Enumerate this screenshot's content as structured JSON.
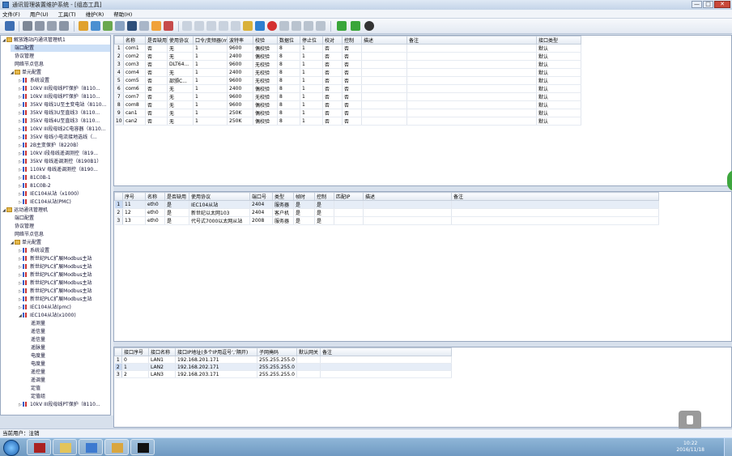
{
  "window": {
    "title": "通讯管理装置维护系统 - [组态工具]",
    "buttons": [
      "—",
      "□",
      "✕"
    ]
  },
  "menu": [
    "文件(F)",
    "用户(U)",
    "工具(T)",
    "维护(R)",
    "帮助(H)"
  ],
  "tree": [
    {
      "label": "解放路站内通讯管理机1",
      "level": 0,
      "icon": "folder",
      "twisty": "◢",
      "selected": false
    },
    {
      "label": "端口配置",
      "level": 1,
      "icon": "none",
      "twisty": "",
      "selected": true
    },
    {
      "label": "协议管理",
      "level": 1,
      "icon": "none",
      "twisty": "",
      "selected": false
    },
    {
      "label": "网络节点信息",
      "level": 1,
      "icon": "none",
      "twisty": "",
      "selected": false
    },
    {
      "label": "单元配置",
      "level": 1,
      "icon": "folder",
      "twisty": "◢",
      "selected": false
    },
    {
      "label": "系统设置",
      "level": 2,
      "icon": "node",
      "twisty": "▷",
      "selected": false
    },
    {
      "label": "10kV III段母线PT保护（8110...",
      "level": 2,
      "icon": "node",
      "twisty": "▷",
      "selected": false
    },
    {
      "label": "10kV III段母线PT保护（8110...",
      "level": 2,
      "icon": "node",
      "twisty": "▷",
      "selected": false
    },
    {
      "label": "35kV 母线1U至主变电站（8110...",
      "level": 2,
      "icon": "node",
      "twisty": "▷",
      "selected": false
    },
    {
      "label": "35kV 母线3U至直线3（8110...",
      "level": 2,
      "icon": "node",
      "twisty": "▷",
      "selected": false
    },
    {
      "label": "35kV 母线4U至直线3（8110...",
      "level": 2,
      "icon": "node",
      "twisty": "▷",
      "selected": false
    },
    {
      "label": "10kV III段母线2C电容器（8110...",
      "level": 2,
      "icon": "node",
      "twisty": "▷",
      "selected": false
    },
    {
      "label": "35kV 母线小电流接地选线（...",
      "level": 2,
      "icon": "node",
      "twisty": "▷",
      "selected": false
    },
    {
      "label": "2B主变保护（8220B）",
      "level": 2,
      "icon": "node",
      "twisty": "▷",
      "selected": false
    },
    {
      "label": "10kV I段母线遥调测控（819...",
      "level": 2,
      "icon": "node",
      "twisty": "▷",
      "selected": false
    },
    {
      "label": "35kV 母线遥调测控（8190B1）",
      "level": 2,
      "icon": "node",
      "twisty": "▷",
      "selected": false
    },
    {
      "label": "110kV 母线遥调测控（8190...",
      "level": 2,
      "icon": "node",
      "twisty": "▷",
      "selected": false
    },
    {
      "label": "81C0B-1",
      "level": 2,
      "icon": "node",
      "twisty": "▷",
      "selected": false
    },
    {
      "label": "81C0B-2",
      "level": 2,
      "icon": "node",
      "twisty": "▷",
      "selected": false
    },
    {
      "label": "IEC104从站（x1000）",
      "level": 2,
      "icon": "node",
      "twisty": "▷",
      "selected": false
    },
    {
      "label": "IEC104从站(PMC)",
      "level": 2,
      "icon": "node",
      "twisty": "▷",
      "selected": false
    },
    {
      "label": "运动通讯管理机",
      "level": 0,
      "icon": "folder",
      "twisty": "◢",
      "selected": false
    },
    {
      "label": "端口配置",
      "level": 1,
      "icon": "none",
      "twisty": "",
      "selected": false
    },
    {
      "label": "协议管理",
      "level": 1,
      "icon": "none",
      "twisty": "",
      "selected": false
    },
    {
      "label": "网络节点信息",
      "level": 1,
      "icon": "none",
      "twisty": "",
      "selected": false
    },
    {
      "label": "单元配置",
      "level": 1,
      "icon": "folder",
      "twisty": "◢",
      "selected": false
    },
    {
      "label": "系统设置",
      "level": 2,
      "icon": "node",
      "twisty": "▷",
      "selected": false
    },
    {
      "label": "新世纪PLC扩展Modbus主站",
      "level": 2,
      "icon": "node",
      "twisty": "▷",
      "selected": false
    },
    {
      "label": "新世纪PLC扩展Modbus主站",
      "level": 2,
      "icon": "node",
      "twisty": "▷",
      "selected": false
    },
    {
      "label": "新世纪PLC扩展Modbus主站",
      "level": 2,
      "icon": "node",
      "twisty": "▷",
      "selected": false
    },
    {
      "label": "新世纪PLC扩展Modbus主站",
      "level": 2,
      "icon": "node",
      "twisty": "▷",
      "selected": false
    },
    {
      "label": "新世纪PLC扩展Modbus主站",
      "level": 2,
      "icon": "node",
      "twisty": "▷",
      "selected": false
    },
    {
      "label": "新世纪PLC扩展Modbus主站",
      "level": 2,
      "icon": "node",
      "twisty": "▷",
      "selected": false
    },
    {
      "label": "IEC104从站(pmc)",
      "level": 2,
      "icon": "node",
      "twisty": "▷",
      "selected": false
    },
    {
      "label": "IEC104从站(x1000)",
      "level": 2,
      "icon": "node",
      "twisty": "◢",
      "selected": false
    },
    {
      "label": "遥测量",
      "level": 3,
      "icon": "none",
      "twisty": "",
      "selected": false
    },
    {
      "label": "遥信量",
      "level": 3,
      "icon": "none",
      "twisty": "",
      "selected": false
    },
    {
      "label": "遥信量",
      "level": 3,
      "icon": "none",
      "twisty": "",
      "selected": false
    },
    {
      "label": "遥脉量",
      "level": 3,
      "icon": "none",
      "twisty": "",
      "selected": false
    },
    {
      "label": "电度量",
      "level": 3,
      "icon": "none",
      "twisty": "",
      "selected": false
    },
    {
      "label": "电度量",
      "level": 3,
      "icon": "none",
      "twisty": "",
      "selected": false
    },
    {
      "label": "遥控量",
      "level": 3,
      "icon": "none",
      "twisty": "",
      "selected": false
    },
    {
      "label": "遥调量",
      "level": 3,
      "icon": "none",
      "twisty": "",
      "selected": false
    },
    {
      "label": "定值",
      "level": 3,
      "icon": "none",
      "twisty": "",
      "selected": false
    },
    {
      "label": "定值组",
      "level": 3,
      "icon": "none",
      "twisty": "",
      "selected": false
    },
    {
      "label": "10kV III段母线PT保护（8110...",
      "level": 2,
      "icon": "node",
      "twisty": "▷",
      "selected": false
    }
  ],
  "serial_table": {
    "headers": [
      "",
      "名称",
      "是否缺用",
      "使用协议",
      "口令/变频器(ms)",
      "波特率",
      "校验",
      "数据位",
      "停止位",
      "校对",
      "控制",
      "描述",
      "备注",
      "接口类型"
    ],
    "rows": [
      [
        "1",
        "com1",
        "否",
        "无",
        "1",
        "9600",
        "偶校验",
        "8",
        "1",
        "否",
        "否",
        "",
        "",
        "默认"
      ],
      [
        "2",
        "com2",
        "否",
        "无",
        "1",
        "2400",
        "偶校验",
        "8",
        "1",
        "否",
        "否",
        "",
        "",
        "默认"
      ],
      [
        "3",
        "com3",
        "否",
        "DLT64...",
        "1",
        "9600",
        "无校验",
        "8",
        "1",
        "否",
        "否",
        "",
        "",
        "默认"
      ],
      [
        "4",
        "com4",
        "否",
        "无",
        "1",
        "2400",
        "无校验",
        "8",
        "1",
        "否",
        "否",
        "",
        "",
        "默认"
      ],
      [
        "5",
        "com5",
        "否",
        "部颁C...",
        "1",
        "9600",
        "无校验",
        "8",
        "1",
        "否",
        "否",
        "",
        "",
        "默认"
      ],
      [
        "6",
        "com6",
        "否",
        "无",
        "1",
        "2400",
        "偶校验",
        "8",
        "1",
        "否",
        "否",
        "",
        "",
        "默认"
      ],
      [
        "7",
        "com7",
        "否",
        "无",
        "1",
        "9600",
        "无校验",
        "8",
        "1",
        "否",
        "否",
        "",
        "",
        "默认"
      ],
      [
        "8",
        "com8",
        "否",
        "无",
        "1",
        "9600",
        "偶校验",
        "8",
        "1",
        "否",
        "否",
        "",
        "",
        "默认"
      ],
      [
        "9",
        "can1",
        "否",
        "无",
        "1",
        "250K",
        "偶校验",
        "8",
        "1",
        "否",
        "否",
        "",
        "",
        "默认"
      ],
      [
        "10",
        "can2",
        "否",
        "无",
        "1",
        "250K",
        "偶校验",
        "8",
        "1",
        "否",
        "否",
        "",
        "",
        "默认"
      ]
    ]
  },
  "net_table": {
    "headers": [
      "",
      "序号",
      "名称",
      "是否缺用",
      "使用协议",
      "端口号",
      "类型",
      "帧时",
      "控制",
      "匹配IP",
      "描述",
      "备注"
    ],
    "rows": [
      [
        "1",
        "11",
        "eth0",
        "是",
        "IEC104从站",
        "2404",
        "服务器",
        "是",
        "是",
        "",
        "",
        ""
      ],
      [
        "2",
        "12",
        "eth0",
        "是",
        "新世纪以太网103",
        "2404",
        "客户机",
        "是",
        "是",
        "",
        "",
        ""
      ],
      [
        "3",
        "13",
        "eth0",
        "是",
        "代号式7000以太网从站",
        "2008",
        "服务器",
        "是",
        "是",
        "",
        "",
        ""
      ]
    ]
  },
  "ip_table": {
    "headers": [
      "",
      "接口序号",
      "接口名称",
      "接口IP地址(多个IP用逗号‘,’隔开)",
      "子网掩码",
      "默认网关",
      "备注"
    ],
    "rows": [
      [
        "1",
        "0",
        "LAN1",
        "192.168.201.171",
        "255.255.255.0",
        "",
        ""
      ],
      [
        "2",
        "1",
        "LAN2",
        "192.168.202.171",
        "255.255.255.0",
        "",
        ""
      ],
      [
        "3",
        "2",
        "LAN3",
        "192.168.203.171",
        "255.255.255.0",
        "",
        ""
      ]
    ]
  },
  "status": {
    "text": "当前用户：注销"
  },
  "clock": {
    "time": "10:22",
    "date": "2016/11/18"
  }
}
